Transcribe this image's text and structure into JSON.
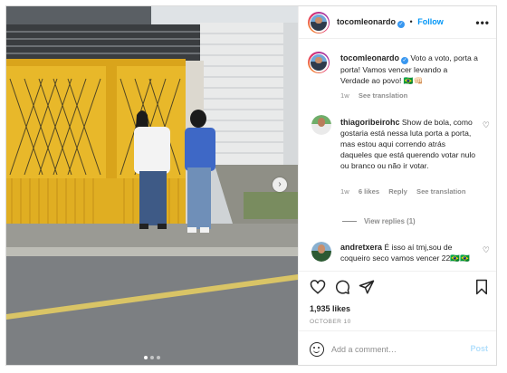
{
  "post": {
    "username": "tocomleonardo",
    "follow_label": "Follow",
    "separator": "•",
    "more_label": "•••",
    "caption": "Voto a voto, porta a porta! Vamos vencer levando a Verdade ao povo! 🇧🇷👊🏻",
    "caption_time": "1w",
    "caption_translate": "See translation",
    "likes": "1,935 likes",
    "date": "OCTOBER 10",
    "add_comment_placeholder": "Add a comment…",
    "post_label": "Post",
    "next_icon": "chevron-right-icon",
    "carousel_dots": 3
  },
  "comments": [
    {
      "username": "thiagoribeirohc",
      "text": "Show de bola, como gostaria está nessa luta porta a porta, mas estou aqui correndo atrás daqueles que está querendo votar nulo ou branco ou não ir votar.",
      "time": "1w",
      "likes": "6 likes",
      "reply": "Reply",
      "translate": "See translation",
      "view_replies": "View replies (1)"
    },
    {
      "username": "andretxera",
      "text": "É isso aí tmj,sou de coqueiro seco vamos vencer 22🇧🇷🇧🇷"
    }
  ],
  "colors": {
    "accent": "#0095f6",
    "verified": "#3897f0",
    "muted": "#8e8e8e",
    "post_disabled": "#b2dffc",
    "gate_yellow": "#e8b82a"
  },
  "icons": [
    "heart-icon",
    "comment-icon",
    "share-icon",
    "bookmark-icon",
    "emoji-icon",
    "verified-icon",
    "more-icon"
  ]
}
